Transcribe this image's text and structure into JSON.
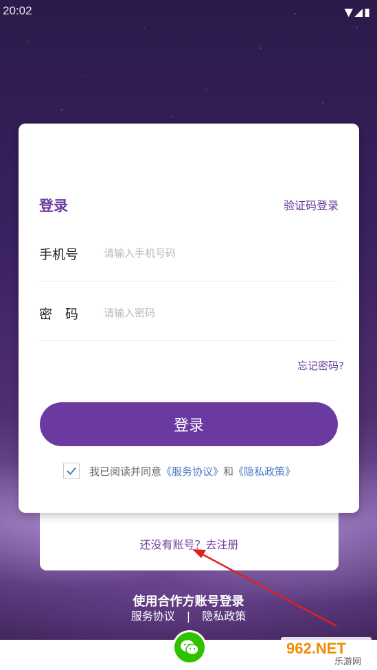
{
  "status_bar": {
    "time": "20:02",
    "icons": "▼◢▮"
  },
  "login": {
    "title": "登录",
    "sms_login": "验证码登录",
    "phone_label": "手机号",
    "phone_placeholder": "请输入手机号码",
    "password_label": "密　码",
    "password_placeholder": "请输入密码",
    "forgot": "忘记密码?",
    "button": "登录",
    "agree_text": "我已阅读并同意",
    "service_link": "《服务协议》",
    "and": "和",
    "privacy_link": "《隐私政策》",
    "agree_checked": true
  },
  "register": {
    "text": "还没有账号？去注册"
  },
  "partner": {
    "title": "使用合作方账号登录",
    "service": "服务协议",
    "separator": "|",
    "privacy": "隐私政策"
  },
  "watermark": {
    "text_main": "962.NET",
    "text_sub": "乐游网"
  },
  "colors": {
    "accent": "#6b3aa0",
    "link": "#4a78c4",
    "wechat": "#2dc100"
  },
  "icons": [
    "check-icon",
    "wechat-icon",
    "arrow-annotation"
  ]
}
